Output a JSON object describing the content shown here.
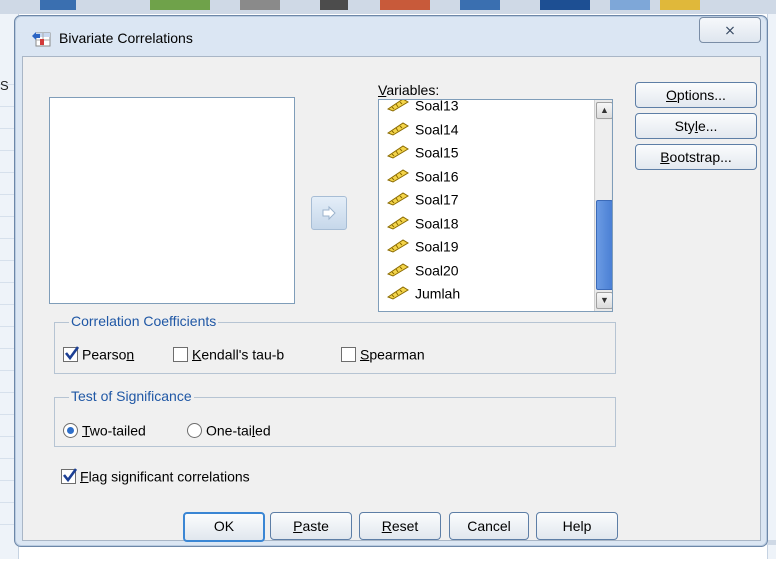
{
  "window": {
    "title": "Bivariate Correlations",
    "close_glyph": "⨯"
  },
  "background_app": {
    "left_edge_letter": "S"
  },
  "variables": {
    "label": "Variables:",
    "items": [
      "Soal13",
      "Soal14",
      "Soal15",
      "Soal16",
      "Soal17",
      "Soal18",
      "Soal19",
      "Soal20",
      "Jumlah"
    ],
    "item_icon": "scale-ruler-icon"
  },
  "side_buttons": {
    "options": "Options...",
    "style": "Style...",
    "bootstrap": "Bootstrap..."
  },
  "correlation_coefficients": {
    "title": "Correlation Coefficients",
    "pearson": {
      "label": "Pearson",
      "checked": true
    },
    "kendall": {
      "label": "Kendall's tau-b",
      "checked": false
    },
    "spearman": {
      "label": "Spearman",
      "checked": false
    }
  },
  "test_of_significance": {
    "title": "Test of Significance",
    "two_tailed": {
      "label": "Two-tailed",
      "selected": true
    },
    "one_tailed": {
      "label": "One-tailed",
      "selected": false
    }
  },
  "flag_significant": {
    "label": "Flag significant correlations",
    "checked": true
  },
  "buttons": {
    "ok": "OK",
    "paste": "Paste",
    "reset": "Reset",
    "cancel": "Cancel",
    "help": "Help"
  },
  "colors": {
    "group_title": "#1f57a5",
    "dialog_frame": "#dbe6f3",
    "scroll_thumb": "#4a7fd4"
  }
}
